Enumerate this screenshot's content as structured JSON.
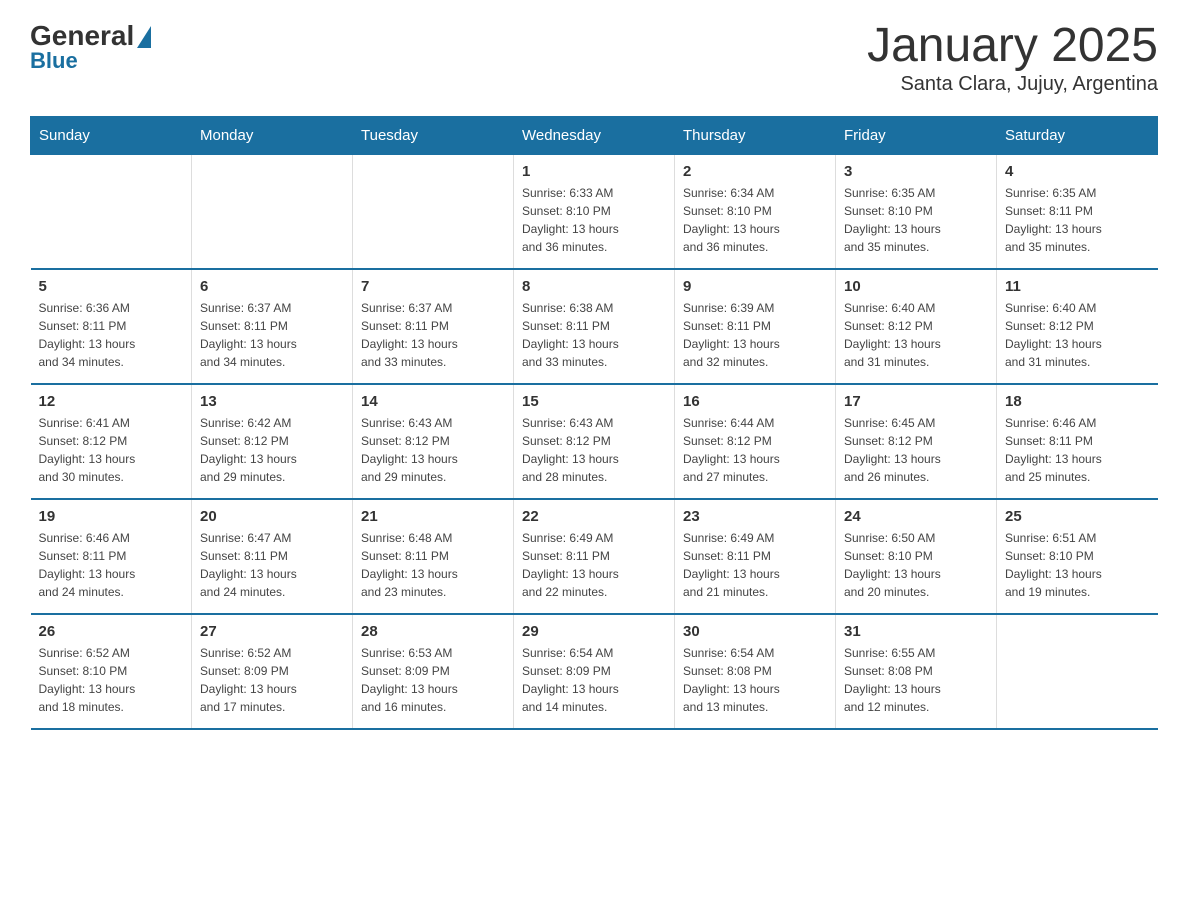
{
  "header": {
    "logo_general": "General",
    "logo_blue": "Blue",
    "title": "January 2025",
    "subtitle": "Santa Clara, Jujuy, Argentina"
  },
  "days_of_week": [
    "Sunday",
    "Monday",
    "Tuesday",
    "Wednesday",
    "Thursday",
    "Friday",
    "Saturday"
  ],
  "weeks": [
    [
      {
        "day": "",
        "info": ""
      },
      {
        "day": "",
        "info": ""
      },
      {
        "day": "",
        "info": ""
      },
      {
        "day": "1",
        "info": "Sunrise: 6:33 AM\nSunset: 8:10 PM\nDaylight: 13 hours\nand 36 minutes."
      },
      {
        "day": "2",
        "info": "Sunrise: 6:34 AM\nSunset: 8:10 PM\nDaylight: 13 hours\nand 36 minutes."
      },
      {
        "day": "3",
        "info": "Sunrise: 6:35 AM\nSunset: 8:10 PM\nDaylight: 13 hours\nand 35 minutes."
      },
      {
        "day": "4",
        "info": "Sunrise: 6:35 AM\nSunset: 8:11 PM\nDaylight: 13 hours\nand 35 minutes."
      }
    ],
    [
      {
        "day": "5",
        "info": "Sunrise: 6:36 AM\nSunset: 8:11 PM\nDaylight: 13 hours\nand 34 minutes."
      },
      {
        "day": "6",
        "info": "Sunrise: 6:37 AM\nSunset: 8:11 PM\nDaylight: 13 hours\nand 34 minutes."
      },
      {
        "day": "7",
        "info": "Sunrise: 6:37 AM\nSunset: 8:11 PM\nDaylight: 13 hours\nand 33 minutes."
      },
      {
        "day": "8",
        "info": "Sunrise: 6:38 AM\nSunset: 8:11 PM\nDaylight: 13 hours\nand 33 minutes."
      },
      {
        "day": "9",
        "info": "Sunrise: 6:39 AM\nSunset: 8:11 PM\nDaylight: 13 hours\nand 32 minutes."
      },
      {
        "day": "10",
        "info": "Sunrise: 6:40 AM\nSunset: 8:12 PM\nDaylight: 13 hours\nand 31 minutes."
      },
      {
        "day": "11",
        "info": "Sunrise: 6:40 AM\nSunset: 8:12 PM\nDaylight: 13 hours\nand 31 minutes."
      }
    ],
    [
      {
        "day": "12",
        "info": "Sunrise: 6:41 AM\nSunset: 8:12 PM\nDaylight: 13 hours\nand 30 minutes."
      },
      {
        "day": "13",
        "info": "Sunrise: 6:42 AM\nSunset: 8:12 PM\nDaylight: 13 hours\nand 29 minutes."
      },
      {
        "day": "14",
        "info": "Sunrise: 6:43 AM\nSunset: 8:12 PM\nDaylight: 13 hours\nand 29 minutes."
      },
      {
        "day": "15",
        "info": "Sunrise: 6:43 AM\nSunset: 8:12 PM\nDaylight: 13 hours\nand 28 minutes."
      },
      {
        "day": "16",
        "info": "Sunrise: 6:44 AM\nSunset: 8:12 PM\nDaylight: 13 hours\nand 27 minutes."
      },
      {
        "day": "17",
        "info": "Sunrise: 6:45 AM\nSunset: 8:12 PM\nDaylight: 13 hours\nand 26 minutes."
      },
      {
        "day": "18",
        "info": "Sunrise: 6:46 AM\nSunset: 8:11 PM\nDaylight: 13 hours\nand 25 minutes."
      }
    ],
    [
      {
        "day": "19",
        "info": "Sunrise: 6:46 AM\nSunset: 8:11 PM\nDaylight: 13 hours\nand 24 minutes."
      },
      {
        "day": "20",
        "info": "Sunrise: 6:47 AM\nSunset: 8:11 PM\nDaylight: 13 hours\nand 24 minutes."
      },
      {
        "day": "21",
        "info": "Sunrise: 6:48 AM\nSunset: 8:11 PM\nDaylight: 13 hours\nand 23 minutes."
      },
      {
        "day": "22",
        "info": "Sunrise: 6:49 AM\nSunset: 8:11 PM\nDaylight: 13 hours\nand 22 minutes."
      },
      {
        "day": "23",
        "info": "Sunrise: 6:49 AM\nSunset: 8:11 PM\nDaylight: 13 hours\nand 21 minutes."
      },
      {
        "day": "24",
        "info": "Sunrise: 6:50 AM\nSunset: 8:10 PM\nDaylight: 13 hours\nand 20 minutes."
      },
      {
        "day": "25",
        "info": "Sunrise: 6:51 AM\nSunset: 8:10 PM\nDaylight: 13 hours\nand 19 minutes."
      }
    ],
    [
      {
        "day": "26",
        "info": "Sunrise: 6:52 AM\nSunset: 8:10 PM\nDaylight: 13 hours\nand 18 minutes."
      },
      {
        "day": "27",
        "info": "Sunrise: 6:52 AM\nSunset: 8:09 PM\nDaylight: 13 hours\nand 17 minutes."
      },
      {
        "day": "28",
        "info": "Sunrise: 6:53 AM\nSunset: 8:09 PM\nDaylight: 13 hours\nand 16 minutes."
      },
      {
        "day": "29",
        "info": "Sunrise: 6:54 AM\nSunset: 8:09 PM\nDaylight: 13 hours\nand 14 minutes."
      },
      {
        "day": "30",
        "info": "Sunrise: 6:54 AM\nSunset: 8:08 PM\nDaylight: 13 hours\nand 13 minutes."
      },
      {
        "day": "31",
        "info": "Sunrise: 6:55 AM\nSunset: 8:08 PM\nDaylight: 13 hours\nand 12 minutes."
      },
      {
        "day": "",
        "info": ""
      }
    ]
  ]
}
